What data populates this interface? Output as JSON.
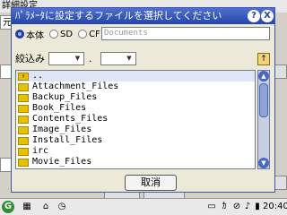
{
  "background_app": {
    "title": "詳細設定",
    "field_text": "元"
  },
  "dialog": {
    "title": "ﾊﾟﾗﾒｰﾀに設定するファイルを選択してください",
    "help_label": "?",
    "close_label": "X",
    "sources": [
      {
        "label": "本体",
        "selected": true
      },
      {
        "label": "SD",
        "selected": false
      },
      {
        "label": "CF",
        "selected": false
      }
    ],
    "path": "Documents",
    "filter_label": "絞込み",
    "filter_separator": ".",
    "files": [
      {
        "name": "..",
        "type": "up"
      },
      {
        "name": "Attachment_Files",
        "type": "folder"
      },
      {
        "name": "Backup_Files",
        "type": "folder"
      },
      {
        "name": "Book_Files",
        "type": "folder"
      },
      {
        "name": "Contents_Files",
        "type": "folder"
      },
      {
        "name": "Image_Files",
        "type": "folder"
      },
      {
        "name": "Install_Files",
        "type": "folder"
      },
      {
        "name": "irc",
        "type": "folder"
      },
      {
        "name": "Movie_Files",
        "type": "folder"
      }
    ],
    "cancel_label": "取消"
  },
  "taskbar": {
    "clock": "20:40"
  },
  "colors": {
    "title_bar": "#2544a8",
    "folder": "#e8c200",
    "scrollbar": "#4a67c0"
  }
}
